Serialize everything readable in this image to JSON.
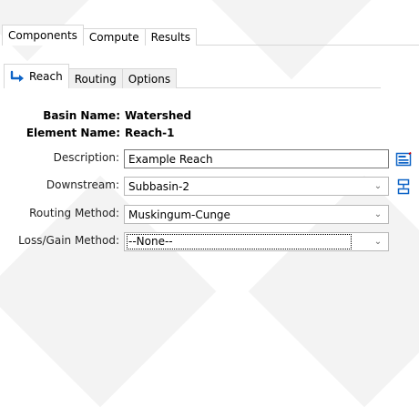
{
  "window": {
    "top_tabs": [
      "Components",
      "Compute",
      "Results"
    ],
    "sub_tabs": [
      "Reach",
      "Routing",
      "Options"
    ]
  },
  "info": {
    "basin_label": "Basin Name:",
    "basin_value": "Watershed",
    "element_label": "Element Name:",
    "element_value": "Reach-1"
  },
  "form": {
    "description_label": "Description:",
    "description_value": "Example Reach",
    "downstream_label": "Downstream:",
    "downstream_value": "Subbasin-2",
    "routing_label": "Routing Method:",
    "routing_value": "Muskingum-Cunge",
    "loss_label": "Loss/Gain Method:",
    "loss_value": "--None--"
  },
  "icons": {
    "reach": "reach-icon",
    "description_editor": "description-editor-icon",
    "downstream_selector": "downstream-selector-icon"
  },
  "colors": {
    "accent": "#0d63c6",
    "border": "#d7d7d7",
    "inactive_tab": "#f0f0f0",
    "text": "#000000",
    "chevron": "#666666"
  }
}
